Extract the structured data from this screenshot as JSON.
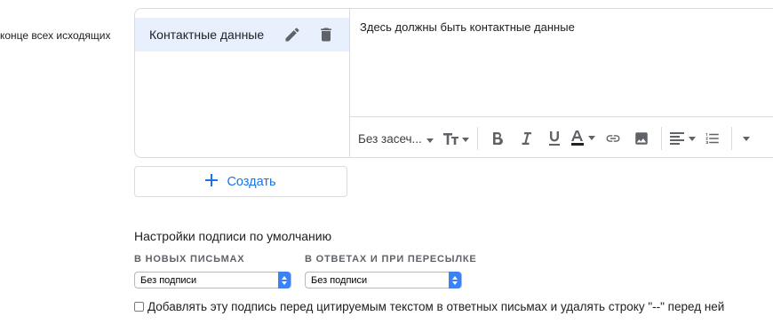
{
  "left_label": "конце всех исходящих",
  "signature": {
    "name": "Контактные данные",
    "body": "Здесь должны быть контактные данные"
  },
  "toolbar": {
    "font_label": "Без засеч..."
  },
  "create_label": "Создать",
  "defaults": {
    "title": "Настройки подписи по умолчанию",
    "new_label": "В НОВЫХ ПИСЬМАХ",
    "reply_label": "В ОТВЕТАХ И ПРИ ПЕРЕСЫЛКЕ",
    "new_value": "Без подписи",
    "reply_value": "Без подписи"
  },
  "checkbox_label": "Добавлять эту подпись перед цитируемым текстом в ответных письмах и удалять строку \"--\" перед ней",
  "colors": {
    "accent": "#1a73e8",
    "selected_bg": "#e8f0fe",
    "select_arrow": "#3b82f6"
  }
}
